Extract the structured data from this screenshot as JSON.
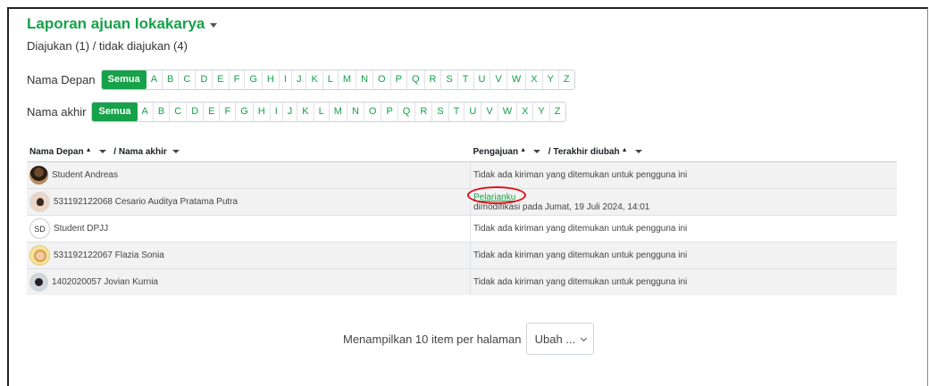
{
  "header": {
    "title": "Laporan ajuan lokakarya",
    "subtitle": "Diajukan (1) / tidak diajukan (4)"
  },
  "filters": {
    "first_name": {
      "label": "Nama Depan",
      "all": "Semua"
    },
    "last_name": {
      "label": "Nama akhir",
      "all": "Semua"
    },
    "letters": [
      "A",
      "B",
      "C",
      "D",
      "E",
      "F",
      "G",
      "H",
      "I",
      "J",
      "K",
      "L",
      "M",
      "N",
      "O",
      "P",
      "Q",
      "R",
      "S",
      "T",
      "U",
      "V",
      "W",
      "X",
      "Y",
      "Z"
    ]
  },
  "table": {
    "col1": {
      "first": "Nama Depan",
      "sep": " / Nama akhir"
    },
    "col2": {
      "first": "Pengajuan",
      "sep": " / Terakhir diubah"
    },
    "rows": [
      {
        "name": "Student Andreas",
        "avatar": "photo",
        "status": "Tidak ada kiriman yang ditemukan untuk pengguna ini"
      },
      {
        "name": "531192122068 Cesario Auditya Pratama Putra",
        "avatar": "photo",
        "link": "Pelarianku",
        "modified": "dimodifikasi pada Jumat, 19 Juli 2024, 14:01"
      },
      {
        "name": "Student DPJJ",
        "avatar": "SD",
        "status": "Tidak ada kiriman yang ditemukan untuk pengguna ini"
      },
      {
        "name": "531192122067 Flazia Sonia",
        "avatar": "photo",
        "status": "Tidak ada kiriman yang ditemukan untuk pengguna ini"
      },
      {
        "name": "1402020057 Jovian Kurnia",
        "avatar": "photo",
        "status": "Tidak ada kiriman yang ditemukan untuk pengguna ini"
      }
    ]
  },
  "paging": {
    "text": "Menampilkan 10 item per halaman",
    "button": "Ubah ..."
  },
  "colors": {
    "accent": "#17a14a",
    "highlight": "#e0141b"
  }
}
